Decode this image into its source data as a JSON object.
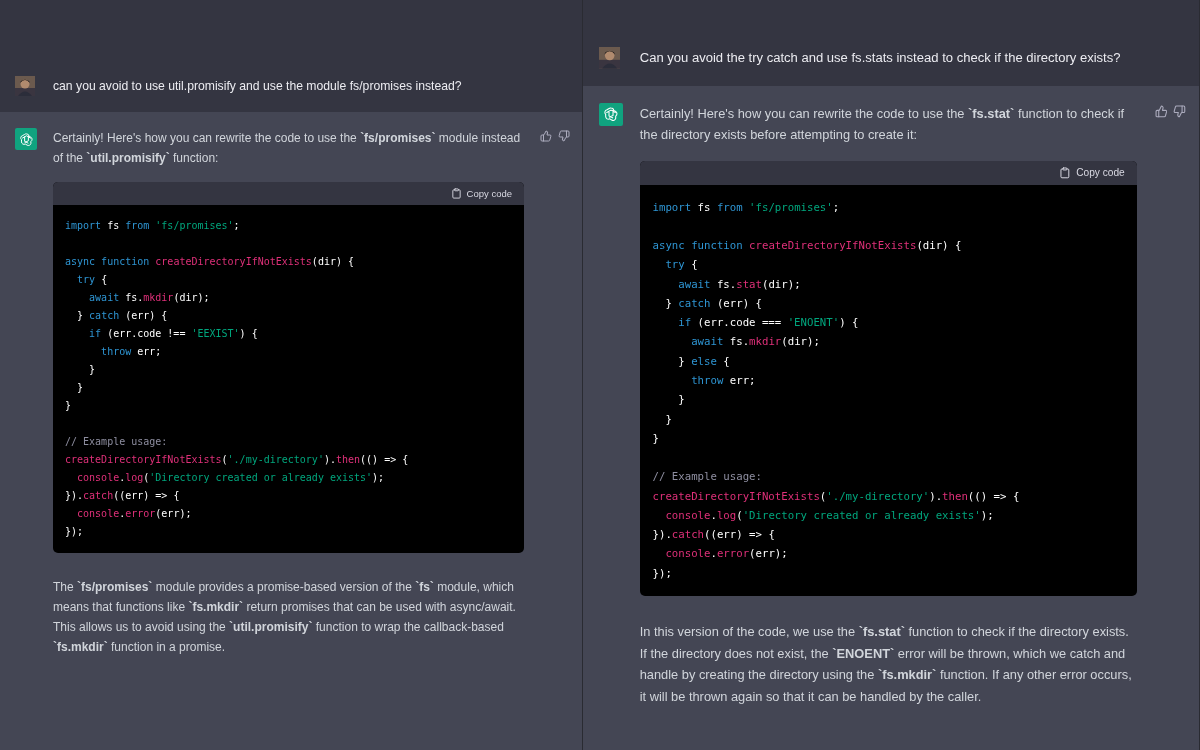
{
  "panels": [
    {
      "user": {
        "text": "can you avoid to use util.promisify and use the module fs/promises instead?"
      },
      "assistant": {
        "intro": "Certainly! Here's how you can rewrite the code to use the **`fs/promises`** module instead of the **`util.promisify`** function:",
        "code": {
          "copy_label": "Copy code",
          "lines": [
            {
              "kind": "code",
              "tokens": [
                {
                  "kind": "kw",
                  "text": "import"
                },
                {
                  "kind": "plain",
                  "text": " fs "
                },
                {
                  "kind": "kw",
                  "text": "from"
                },
                {
                  "kind": "str",
                  "text": " 'fs/promises'"
                },
                {
                  "kind": "plain",
                  "text": ";"
                }
              ]
            },
            {
              "kind": "blank"
            },
            {
              "kind": "code",
              "tokens": [
                {
                  "kind": "kw",
                  "text": "async function"
                },
                {
                  "kind": "fn",
                  "text": " createDirectoryIfNotExists"
                },
                {
                  "kind": "plain",
                  "text": "(dir) {"
                }
              ]
            },
            {
              "kind": "code",
              "tokens": [
                {
                  "kind": "kw",
                  "text": "  try"
                },
                {
                  "kind": "plain",
                  "text": " {"
                }
              ]
            },
            {
              "kind": "code",
              "tokens": [
                {
                  "kind": "kw",
                  "text": "    await"
                },
                {
                  "kind": "plain",
                  "text": " fs."
                },
                {
                  "kind": "fn",
                  "text": "mkdir"
                },
                {
                  "kind": "plain",
                  "text": "(dir);"
                }
              ]
            },
            {
              "kind": "code",
              "tokens": [
                {
                  "kind": "plain",
                  "text": "  } "
                },
                {
                  "kind": "kw",
                  "text": "catch"
                },
                {
                  "kind": "plain",
                  "text": " (err) {"
                }
              ]
            },
            {
              "kind": "code",
              "tokens": [
                {
                  "kind": "kw",
                  "text": "    if"
                },
                {
                  "kind": "plain",
                  "text": " (err.code !== "
                },
                {
                  "kind": "str",
                  "text": "'EEXIST'"
                },
                {
                  "kind": "plain",
                  "text": ") {"
                }
              ]
            },
            {
              "kind": "code",
              "tokens": [
                {
                  "kind": "kw",
                  "text": "      throw"
                },
                {
                  "kind": "plain",
                  "text": " err;"
                }
              ]
            },
            {
              "kind": "code",
              "tokens": [
                {
                  "kind": "plain",
                  "text": "    }"
                }
              ]
            },
            {
              "kind": "code",
              "tokens": [
                {
                  "kind": "plain",
                  "text": "  }"
                }
              ]
            },
            {
              "kind": "code",
              "tokens": [
                {
                  "kind": "plain",
                  "text": "}"
                }
              ]
            },
            {
              "kind": "blank"
            },
            {
              "kind": "code",
              "tokens": [
                {
                  "kind": "comment",
                  "text": "// Example usage:"
                }
              ]
            },
            {
              "kind": "code",
              "tokens": [
                {
                  "kind": "fn",
                  "text": "createDirectoryIfNotExists"
                },
                {
                  "kind": "plain",
                  "text": "("
                },
                {
                  "kind": "str",
                  "text": "'./my-directory'"
                },
                {
                  "kind": "plain",
                  "text": ")."
                },
                {
                  "kind": "fn",
                  "text": "then"
                },
                {
                  "kind": "plain",
                  "text": "(() => {"
                }
              ]
            },
            {
              "kind": "code",
              "tokens": [
                {
                  "kind": "fn",
                  "text": "  console"
                },
                {
                  "kind": "plain",
                  "text": "."
                },
                {
                  "kind": "fn",
                  "text": "log"
                },
                {
                  "kind": "plain",
                  "text": "("
                },
                {
                  "kind": "str",
                  "text": "'Directory created or already exists'"
                },
                {
                  "kind": "plain",
                  "text": ");"
                }
              ]
            },
            {
              "kind": "code",
              "tokens": [
                {
                  "kind": "plain",
                  "text": "})."
                },
                {
                  "kind": "fn",
                  "text": "catch"
                },
                {
                  "kind": "plain",
                  "text": "((err) => {"
                }
              ]
            },
            {
              "kind": "code",
              "tokens": [
                {
                  "kind": "fn",
                  "text": "  console"
                },
                {
                  "kind": "plain",
                  "text": "."
                },
                {
                  "kind": "fn",
                  "text": "error"
                },
                {
                  "kind": "plain",
                  "text": "(err);"
                }
              ]
            },
            {
              "kind": "code",
              "tokens": [
                {
                  "kind": "plain",
                  "text": "});"
                }
              ]
            }
          ]
        },
        "explanation": "The **`fs/promises`** module provides a promise-based version of the **`fs`** module, which means that functions like **`fs.mkdir`** return promises that can be used with async/await. This allows us to avoid using the **`util.promisify`** function to wrap the callback-based **`fs.mkdir`** function in a promise."
      }
    },
    {
      "user": {
        "text": "Can you avoid the try catch and use fs.stats instead to check if the directory exists?"
      },
      "assistant": {
        "intro": "Certainly! Here's how you can rewrite the code to use the **`fs.stat`** function to check if the directory exists before attempting to create it:",
        "code": {
          "copy_label": "Copy code",
          "lines": [
            {
              "kind": "code",
              "tokens": [
                {
                  "kind": "kw",
                  "text": "import"
                },
                {
                  "kind": "plain",
                  "text": " fs "
                },
                {
                  "kind": "kw",
                  "text": "from"
                },
                {
                  "kind": "str",
                  "text": " 'fs/promises'"
                },
                {
                  "kind": "plain",
                  "text": ";"
                }
              ]
            },
            {
              "kind": "blank"
            },
            {
              "kind": "code",
              "tokens": [
                {
                  "kind": "kw",
                  "text": "async function"
                },
                {
                  "kind": "fn",
                  "text": " createDirectoryIfNotExists"
                },
                {
                  "kind": "plain",
                  "text": "(dir) {"
                }
              ]
            },
            {
              "kind": "code",
              "tokens": [
                {
                  "kind": "kw",
                  "text": "  try"
                },
                {
                  "kind": "plain",
                  "text": " {"
                }
              ]
            },
            {
              "kind": "code",
              "tokens": [
                {
                  "kind": "kw",
                  "text": "    await"
                },
                {
                  "kind": "plain",
                  "text": " fs."
                },
                {
                  "kind": "fn",
                  "text": "stat"
                },
                {
                  "kind": "plain",
                  "text": "(dir);"
                }
              ]
            },
            {
              "kind": "code",
              "tokens": [
                {
                  "kind": "plain",
                  "text": "  } "
                },
                {
                  "kind": "kw",
                  "text": "catch"
                },
                {
                  "kind": "plain",
                  "text": " (err) {"
                }
              ]
            },
            {
              "kind": "code",
              "tokens": [
                {
                  "kind": "kw",
                  "text": "    if"
                },
                {
                  "kind": "plain",
                  "text": " (err.code === "
                },
                {
                  "kind": "str",
                  "text": "'ENOENT'"
                },
                {
                  "kind": "plain",
                  "text": ") {"
                }
              ]
            },
            {
              "kind": "code",
              "tokens": [
                {
                  "kind": "kw",
                  "text": "      await"
                },
                {
                  "kind": "plain",
                  "text": " fs."
                },
                {
                  "kind": "fn",
                  "text": "mkdir"
                },
                {
                  "kind": "plain",
                  "text": "(dir);"
                }
              ]
            },
            {
              "kind": "code",
              "tokens": [
                {
                  "kind": "plain",
                  "text": "    } "
                },
                {
                  "kind": "kw",
                  "text": "else"
                },
                {
                  "kind": "plain",
                  "text": " {"
                }
              ]
            },
            {
              "kind": "code",
              "tokens": [
                {
                  "kind": "kw",
                  "text": "      throw"
                },
                {
                  "kind": "plain",
                  "text": " err;"
                }
              ]
            },
            {
              "kind": "code",
              "tokens": [
                {
                  "kind": "plain",
                  "text": "    }"
                }
              ]
            },
            {
              "kind": "code",
              "tokens": [
                {
                  "kind": "plain",
                  "text": "  }"
                }
              ]
            },
            {
              "kind": "code",
              "tokens": [
                {
                  "kind": "plain",
                  "text": "}"
                }
              ]
            },
            {
              "kind": "blank"
            },
            {
              "kind": "code",
              "tokens": [
                {
                  "kind": "comment",
                  "text": "// Example usage:"
                }
              ]
            },
            {
              "kind": "code",
              "tokens": [
                {
                  "kind": "fn",
                  "text": "createDirectoryIfNotExists"
                },
                {
                  "kind": "plain",
                  "text": "("
                },
                {
                  "kind": "str",
                  "text": "'./my-directory'"
                },
                {
                  "kind": "plain",
                  "text": ")."
                },
                {
                  "kind": "fn",
                  "text": "then"
                },
                {
                  "kind": "plain",
                  "text": "(() => {"
                }
              ]
            },
            {
              "kind": "code",
              "tokens": [
                {
                  "kind": "fn",
                  "text": "  console"
                },
                {
                  "kind": "plain",
                  "text": "."
                },
                {
                  "kind": "fn",
                  "text": "log"
                },
                {
                  "kind": "plain",
                  "text": "("
                },
                {
                  "kind": "str",
                  "text": "'Directory created or already exists'"
                },
                {
                  "kind": "plain",
                  "text": ");"
                }
              ]
            },
            {
              "kind": "code",
              "tokens": [
                {
                  "kind": "plain",
                  "text": "})."
                },
                {
                  "kind": "fn",
                  "text": "catch"
                },
                {
                  "kind": "plain",
                  "text": "((err) => {"
                }
              ]
            },
            {
              "kind": "code",
              "tokens": [
                {
                  "kind": "fn",
                  "text": "  console"
                },
                {
                  "kind": "plain",
                  "text": "."
                },
                {
                  "kind": "fn",
                  "text": "error"
                },
                {
                  "kind": "plain",
                  "text": "(err);"
                }
              ]
            },
            {
              "kind": "code",
              "tokens": [
                {
                  "kind": "plain",
                  "text": "});"
                }
              ]
            }
          ]
        },
        "explanation": "In this version of the code, we use the **`fs.stat`** function to check if the directory exists. If the directory does not exist, the **`ENOENT`** error will be thrown, which we catch and handle by creating the directory using the **`fs.mkdir`** function. If any other error occurs, it will be thrown again so that it can be handled by the caller."
      }
    }
  ]
}
